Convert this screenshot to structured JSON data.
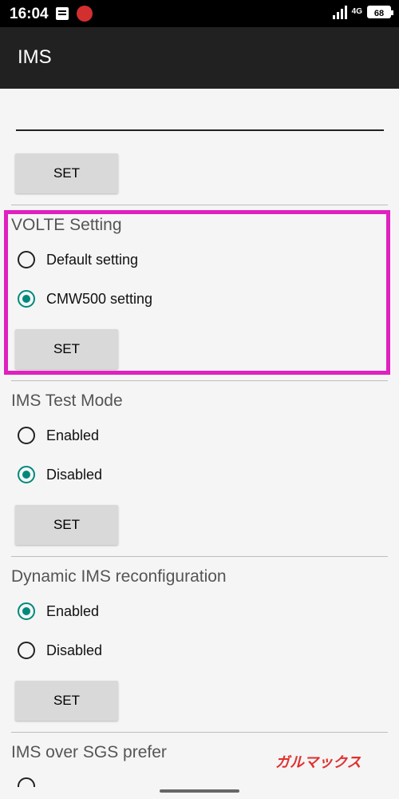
{
  "status_bar": {
    "time": "16:04",
    "network": "4G",
    "battery": "68"
  },
  "app_bar": {
    "title": "IMS"
  },
  "sections": [
    {
      "set_label": "SET"
    },
    {
      "title": "VOLTE Setting",
      "options": [
        {
          "label": "Default setting",
          "checked": false
        },
        {
          "label": "CMW500 setting",
          "checked": true
        }
      ],
      "set_label": "SET"
    },
    {
      "title": "IMS Test Mode",
      "options": [
        {
          "label": "Enabled",
          "checked": false
        },
        {
          "label": "Disabled",
          "checked": true
        }
      ],
      "set_label": "SET"
    },
    {
      "title": "Dynamic IMS reconfiguration",
      "options": [
        {
          "label": "Enabled",
          "checked": true
        },
        {
          "label": "Disabled",
          "checked": false
        }
      ],
      "set_label": "SET"
    },
    {
      "title": "IMS over SGS prefer"
    }
  ],
  "watermark": "ガルマックス",
  "colors": {
    "accent": "#00897b",
    "highlight": "#e020c0",
    "app_bar": "#212121"
  }
}
